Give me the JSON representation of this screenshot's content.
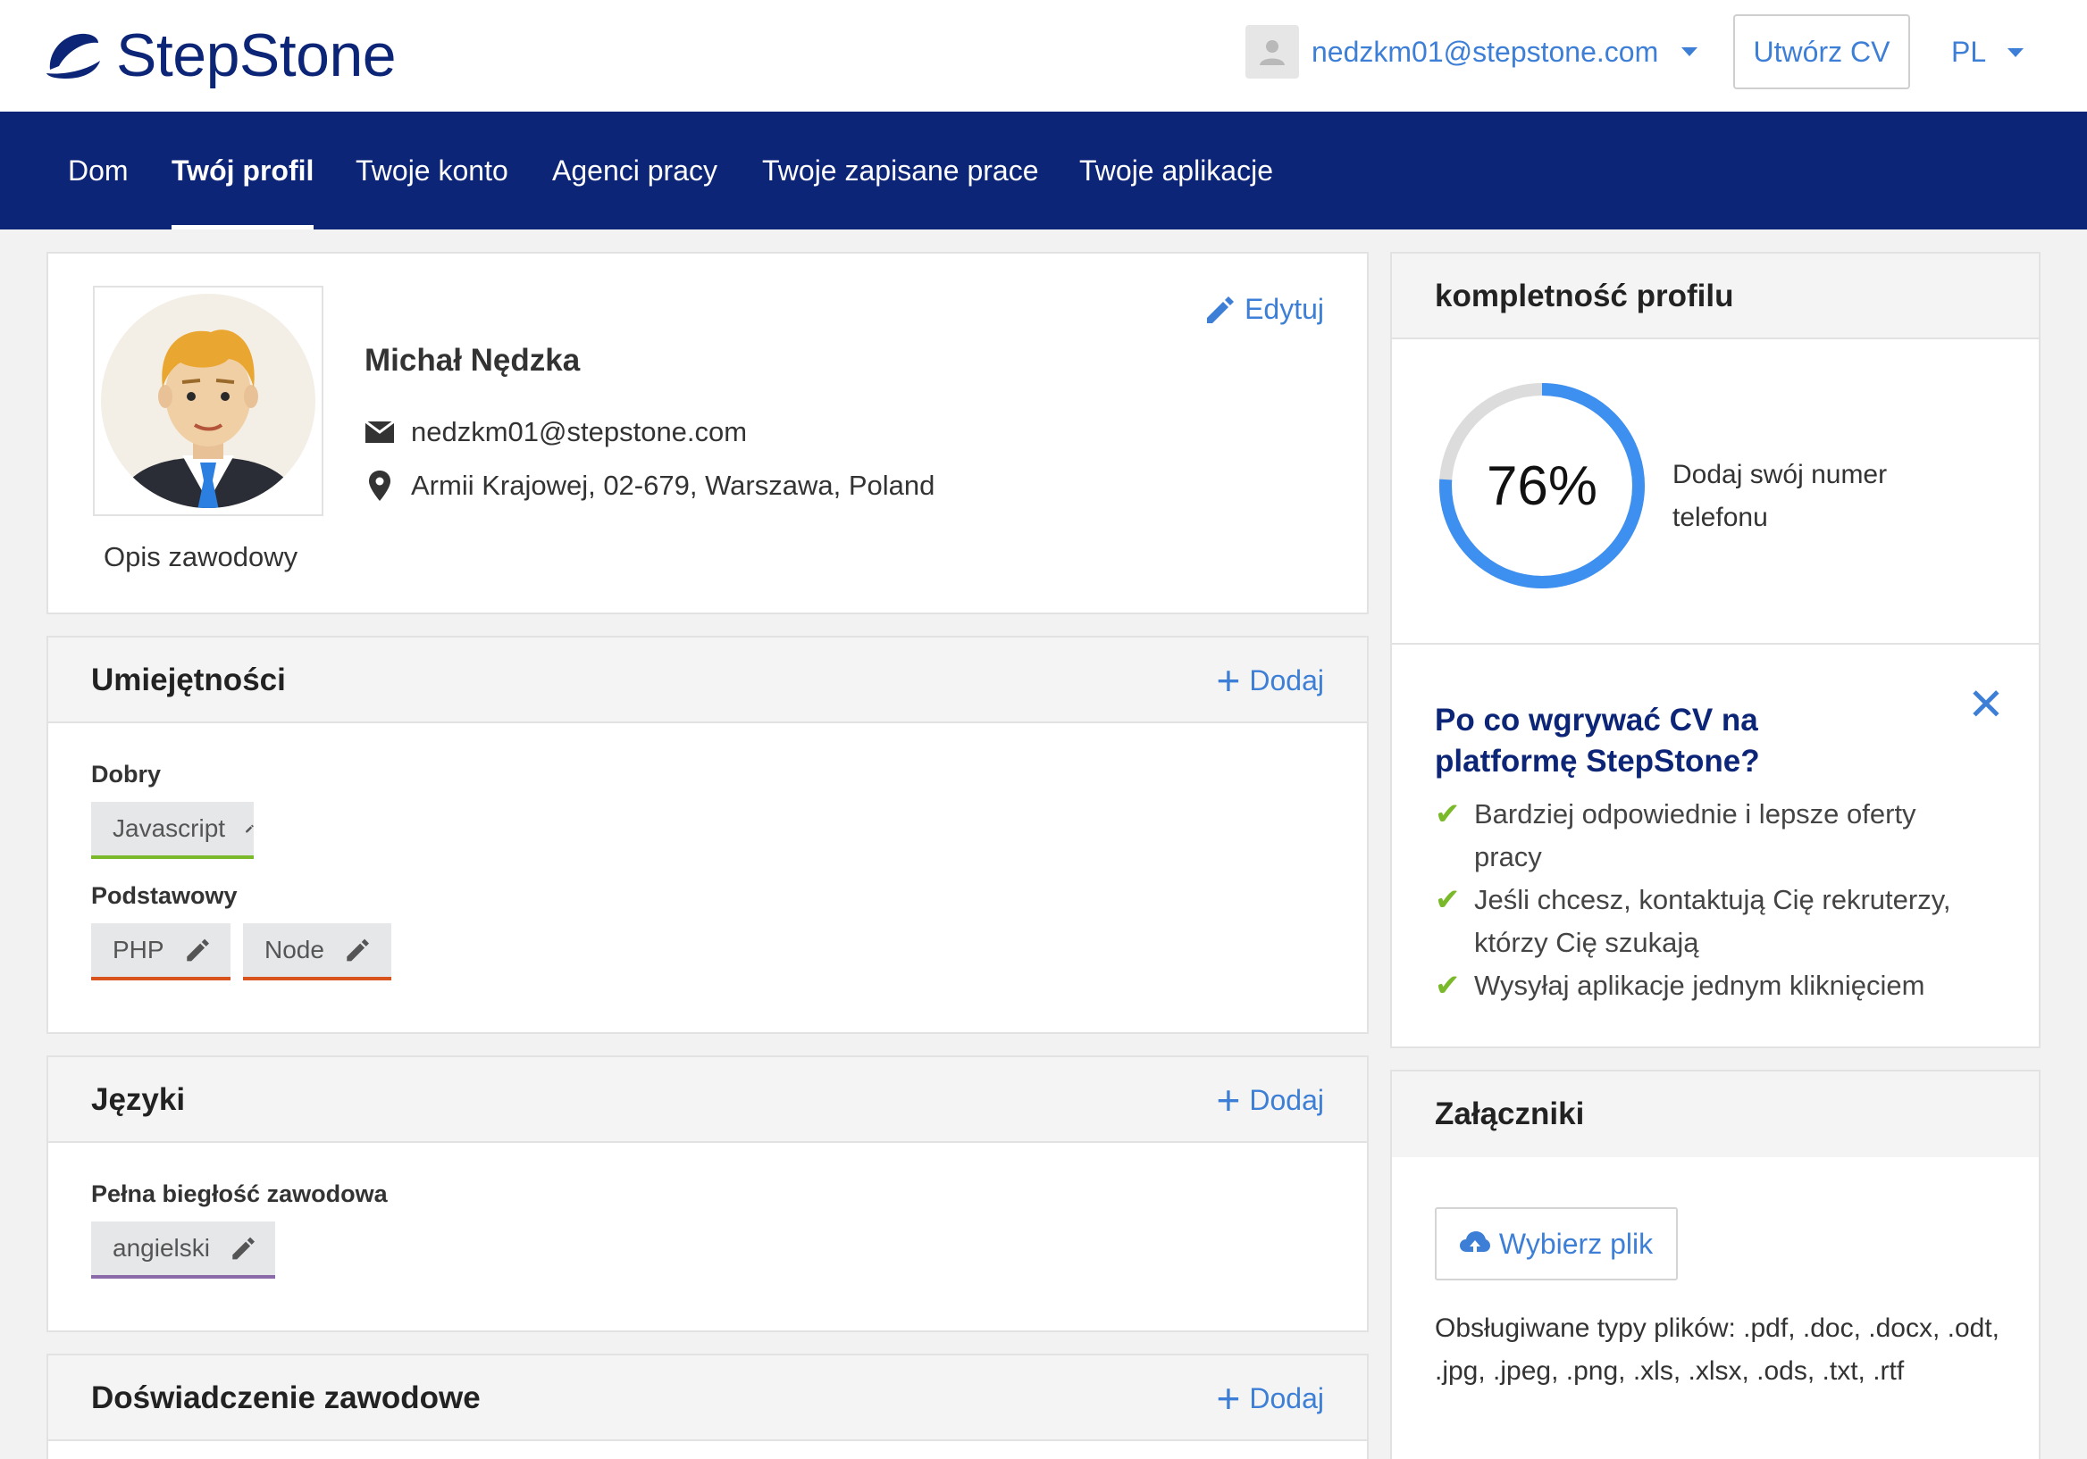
{
  "header": {
    "logo_text": "StepStone",
    "user_email": "nedzkm01@stepstone.com",
    "create_cv_label": "Utwórz CV",
    "language": "PL"
  },
  "nav": {
    "items": [
      {
        "label": "Dom"
      },
      {
        "label": "Twój profil"
      },
      {
        "label": "Twoje konto"
      },
      {
        "label": "Agenci pracy"
      },
      {
        "label": "Twoje zapisane prace"
      },
      {
        "label": "Twoje aplikacje"
      }
    ],
    "active_index": 1
  },
  "profile": {
    "name": "Michał Nędzka",
    "email": "nedzkm01@stepstone.com",
    "address": "Armii Krajowej, 02-679, Warszawa, Poland",
    "edit_label": "Edytuj",
    "description_label": "Opis zawodowy"
  },
  "skills": {
    "title": "Umiejętności",
    "add_label": "Dodaj",
    "groups": [
      {
        "level": "Dobry",
        "items": [
          "Javascript"
        ],
        "color": "#7ab929"
      },
      {
        "level": "Podstawowy",
        "items": [
          "PHP",
          "Node"
        ],
        "color": "#d9531e"
      }
    ]
  },
  "languages": {
    "title": "Języki",
    "add_label": "Dodaj",
    "groups": [
      {
        "level": "Pełna biegłość zawodowa",
        "items": [
          "angielski"
        ],
        "color": "#8a6aa8"
      }
    ]
  },
  "experience": {
    "title": "Doświadczenie zawodowe",
    "add_label": "Dodaj"
  },
  "completeness": {
    "title": "kompletność profilu",
    "percent": 76,
    "percent_label": "76%",
    "hint": "Dodaj swój numer telefonu"
  },
  "promo": {
    "title": "Po co wgrywać CV na platformę StepStone?",
    "bullets": [
      "Bardziej odpowiednie i lepsze oferty pracy",
      "Jeśli chcesz, kontaktują Cię rekruterzy, którzy Cię szukają",
      "Wysyłaj aplikacje jednym kliknięciem"
    ]
  },
  "attachments": {
    "title": "Załączniki",
    "button_label": "Wybierz plik",
    "supported_types": "Obsługiwane typy plików: .pdf, .doc, .docx, .odt, .jpg, .jpeg, .png, .xls, .xlsx, .ods, .txt, .rtf"
  },
  "colors": {
    "brand": "#0c2577",
    "link": "#3d7fd6",
    "check": "#7ab929"
  }
}
